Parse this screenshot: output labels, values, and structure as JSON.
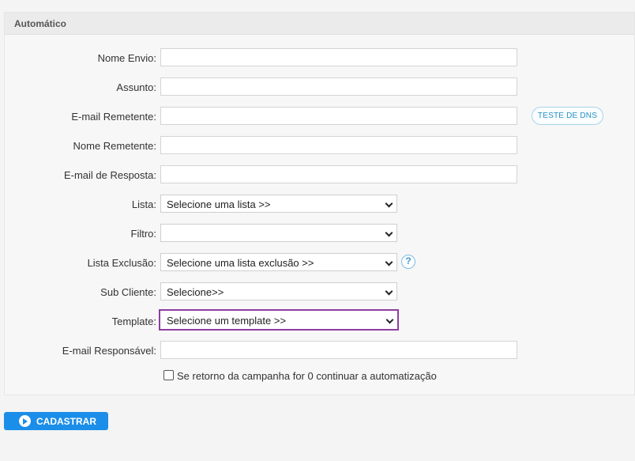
{
  "panel": {
    "title": "Automático"
  },
  "fields": {
    "nome_envio": {
      "label": "Nome Envio:",
      "value": ""
    },
    "assunto": {
      "label": "Assunto:",
      "value": ""
    },
    "email_remetente": {
      "label": "E-mail Remetente:",
      "value": ""
    },
    "nome_remetente": {
      "label": "Nome Remetente:",
      "value": ""
    },
    "email_resposta": {
      "label": "E-mail de Resposta:",
      "value": ""
    },
    "lista": {
      "label": "Lista:",
      "selected": "Selecione uma lista >>"
    },
    "filtro": {
      "label": "Filtro:",
      "selected": ""
    },
    "lista_exclusao": {
      "label": "Lista Exclusão:",
      "selected": "Selecione uma lista exclusão >>"
    },
    "sub_cliente": {
      "label": "Sub Cliente:",
      "selected": "Selecione>>"
    },
    "template": {
      "label": "Template:",
      "selected": "Selecione um template >>"
    },
    "email_responsavel": {
      "label": "E-mail Responsável:",
      "value": ""
    }
  },
  "dns_button": {
    "label": "TESTE DE DNS"
  },
  "help_icon": {
    "glyph": "?",
    "icon": "question-circle-icon"
  },
  "checkbox": {
    "label": "Se retorno da campanha for 0 continuar a automatização",
    "checked": false
  },
  "submit": {
    "label": "CADASTRAR",
    "icon": "play-circle-icon"
  },
  "colors": {
    "accent": "#1a8ee9",
    "highlight_border": "#8e3ea0",
    "link": "#2392c8"
  }
}
